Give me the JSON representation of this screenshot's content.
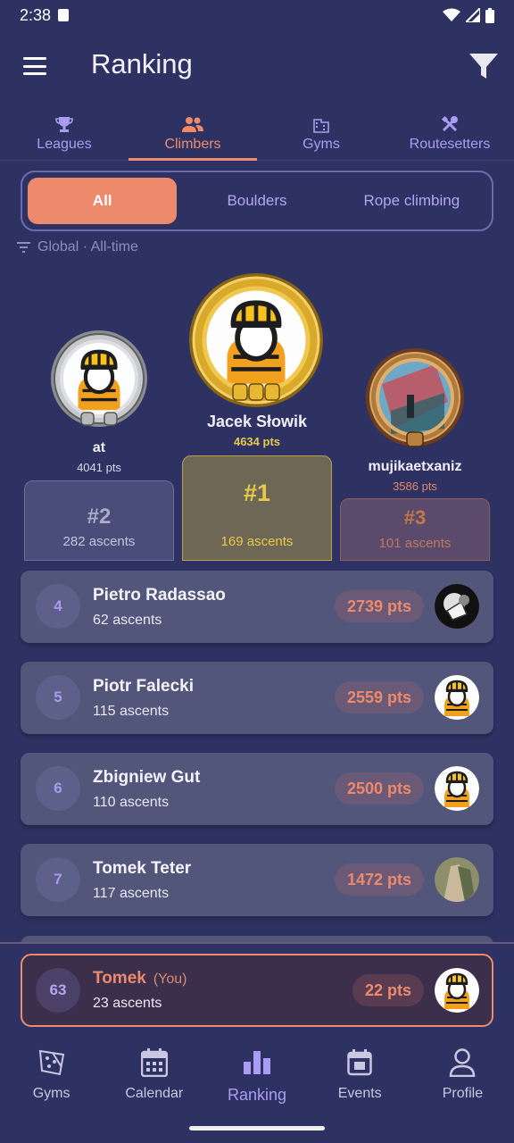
{
  "status": {
    "time": "2:38"
  },
  "appbar": {
    "title": "Ranking"
  },
  "tabs": [
    {
      "label": "Leagues",
      "icon": "trophy-icon"
    },
    {
      "label": "Climbers",
      "icon": "people-icon",
      "active": true
    },
    {
      "label": "Gyms",
      "icon": "building-icon"
    },
    {
      "label": "Routesetters",
      "icon": "tools-icon"
    }
  ],
  "segments": [
    {
      "label": "All",
      "active": true
    },
    {
      "label": "Boulders"
    },
    {
      "label": "Rope climbing"
    }
  ],
  "filter_info": "Global · All-time",
  "podium": {
    "first": {
      "name": "Jacek Słowik",
      "pts": "4634 pts",
      "rank": "#1",
      "ascents": "169 ascents"
    },
    "second": {
      "name": "at",
      "pts": "4041 pts",
      "rank": "#2",
      "ascents": "282 ascents"
    },
    "third": {
      "name": "mujikaetxaniz",
      "pts": "3586 pts",
      "rank": "#3",
      "ascents": "101 ascents"
    }
  },
  "list": [
    {
      "rank": "4",
      "name": "Pietro Radassao",
      "ascents": "62 ascents",
      "pts": "2739 pts"
    },
    {
      "rank": "5",
      "name": "Piotr Falecki",
      "ascents": "115 ascents",
      "pts": "2559 pts"
    },
    {
      "rank": "6",
      "name": "Zbigniew Gut",
      "ascents": "110 ascents",
      "pts": "2500 pts"
    },
    {
      "rank": "7",
      "name": "Tomek Teter",
      "ascents": "117 ascents",
      "pts": "1472 pts"
    }
  ],
  "you": {
    "rank": "63",
    "name": "Tomek",
    "tag": "(You)",
    "ascents": "23 ascents",
    "pts": "22 pts"
  },
  "bottom_nav": [
    {
      "label": "Gyms",
      "icon": "climbing-wall-icon"
    },
    {
      "label": "Calendar",
      "icon": "calendar-icon"
    },
    {
      "label": "Ranking",
      "icon": "bar-chart-icon",
      "active": true
    },
    {
      "label": "Events",
      "icon": "event-icon"
    },
    {
      "label": "Profile",
      "icon": "person-icon"
    }
  ],
  "colors": {
    "background": "#2e3263",
    "accent": "#ee8a6c",
    "purple": "#a99cf2",
    "gold": "#e6c94a"
  }
}
